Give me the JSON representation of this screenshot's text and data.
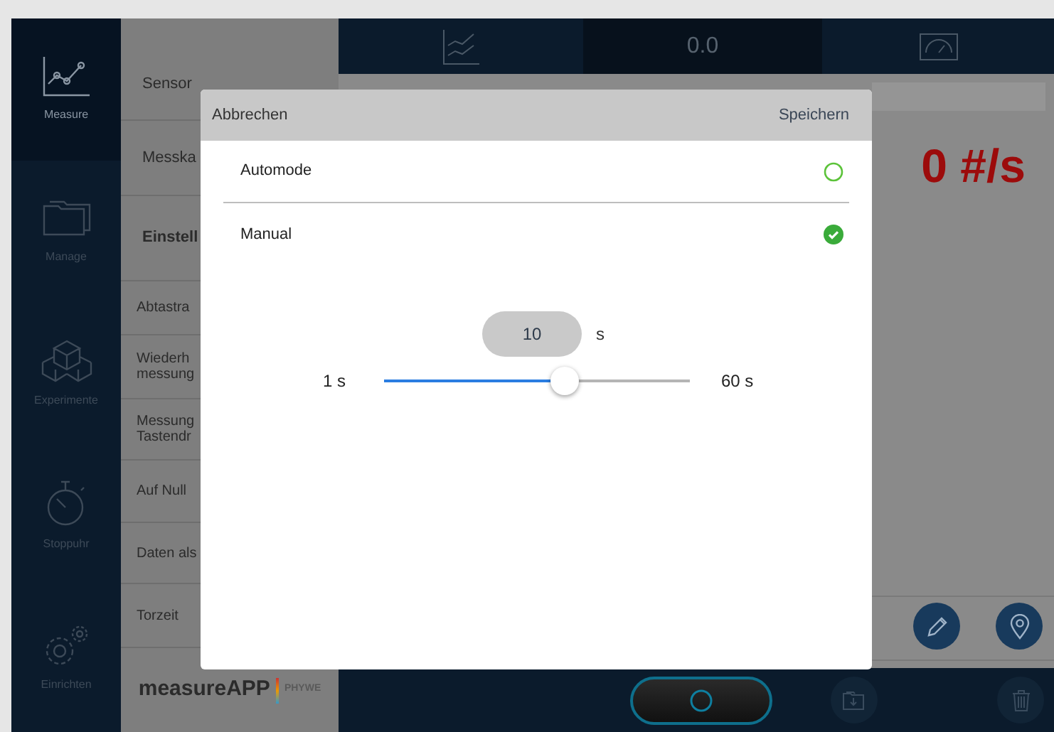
{
  "nav": [
    {
      "label": "Measure",
      "kind": "chart",
      "selected": true
    },
    {
      "label": "Manage",
      "kind": "folder",
      "selected": false
    },
    {
      "label": "Experimente",
      "kind": "cubes",
      "selected": false
    },
    {
      "label": "Stoppuhr",
      "kind": "stopwatch",
      "selected": false
    },
    {
      "label": "Einrichten",
      "kind": "gears",
      "selected": false
    }
  ],
  "settings": [
    {
      "lines": [
        "Sensor"
      ],
      "kind": "section",
      "selected": false
    },
    {
      "lines": [
        "Messka"
      ],
      "kind": "section",
      "selected": false
    },
    {
      "lines": [
        "Einstell"
      ],
      "kind": "section",
      "selected": true
    },
    {
      "lines": [
        "Abtastra"
      ],
      "kind": "option",
      "selected": false
    },
    {
      "lines": [
        "Wiederh",
        "messung"
      ],
      "kind": "option",
      "selected": false
    },
    {
      "lines": [
        "Messung",
        "Tastendr"
      ],
      "kind": "option",
      "selected": false
    },
    {
      "lines": [
        "Auf Null"
      ],
      "kind": "option",
      "selected": false
    },
    {
      "lines": [
        "Daten als"
      ],
      "kind": "option",
      "selected": false
    },
    {
      "lines": [
        "Torzeit"
      ],
      "kind": "option",
      "selected": false
    }
  ],
  "logo": {
    "name": "measureAPP",
    "brand": "PHYWE"
  },
  "view_tabs": [
    {
      "kind": "chart",
      "selected": false
    },
    {
      "kind": "text",
      "label": "0.0",
      "selected": true
    },
    {
      "kind": "gauge",
      "selected": false
    }
  ],
  "reading": "0 #/s",
  "modal": {
    "cancel": "Abbrechen",
    "save": "Speichern",
    "options": [
      {
        "label": "Automode",
        "selected": false
      },
      {
        "label": "Manual",
        "selected": true
      }
    ],
    "value": "10",
    "unit": "s",
    "slider": {
      "min": "1 s",
      "max": "60 s",
      "level": 0.59
    }
  }
}
